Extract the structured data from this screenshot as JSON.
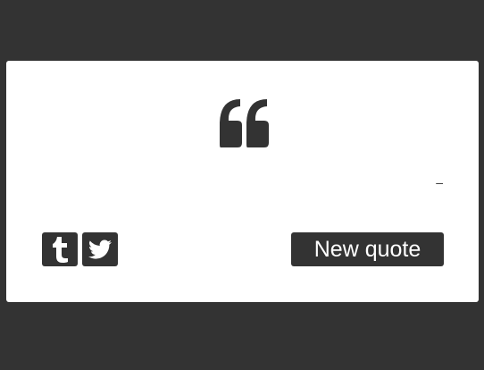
{
  "colors": {
    "background": "#333333",
    "card": "#ffffff",
    "accent": "#333333",
    "button_text": "#ffffff"
  },
  "quote": {
    "icon": "quote-left-icon",
    "text": "",
    "author_prefix": "–",
    "author": ""
  },
  "share": {
    "tumblr_icon": "tumblr-icon",
    "twitter_icon": "twitter-icon"
  },
  "actions": {
    "new_quote_label": "New quote"
  }
}
